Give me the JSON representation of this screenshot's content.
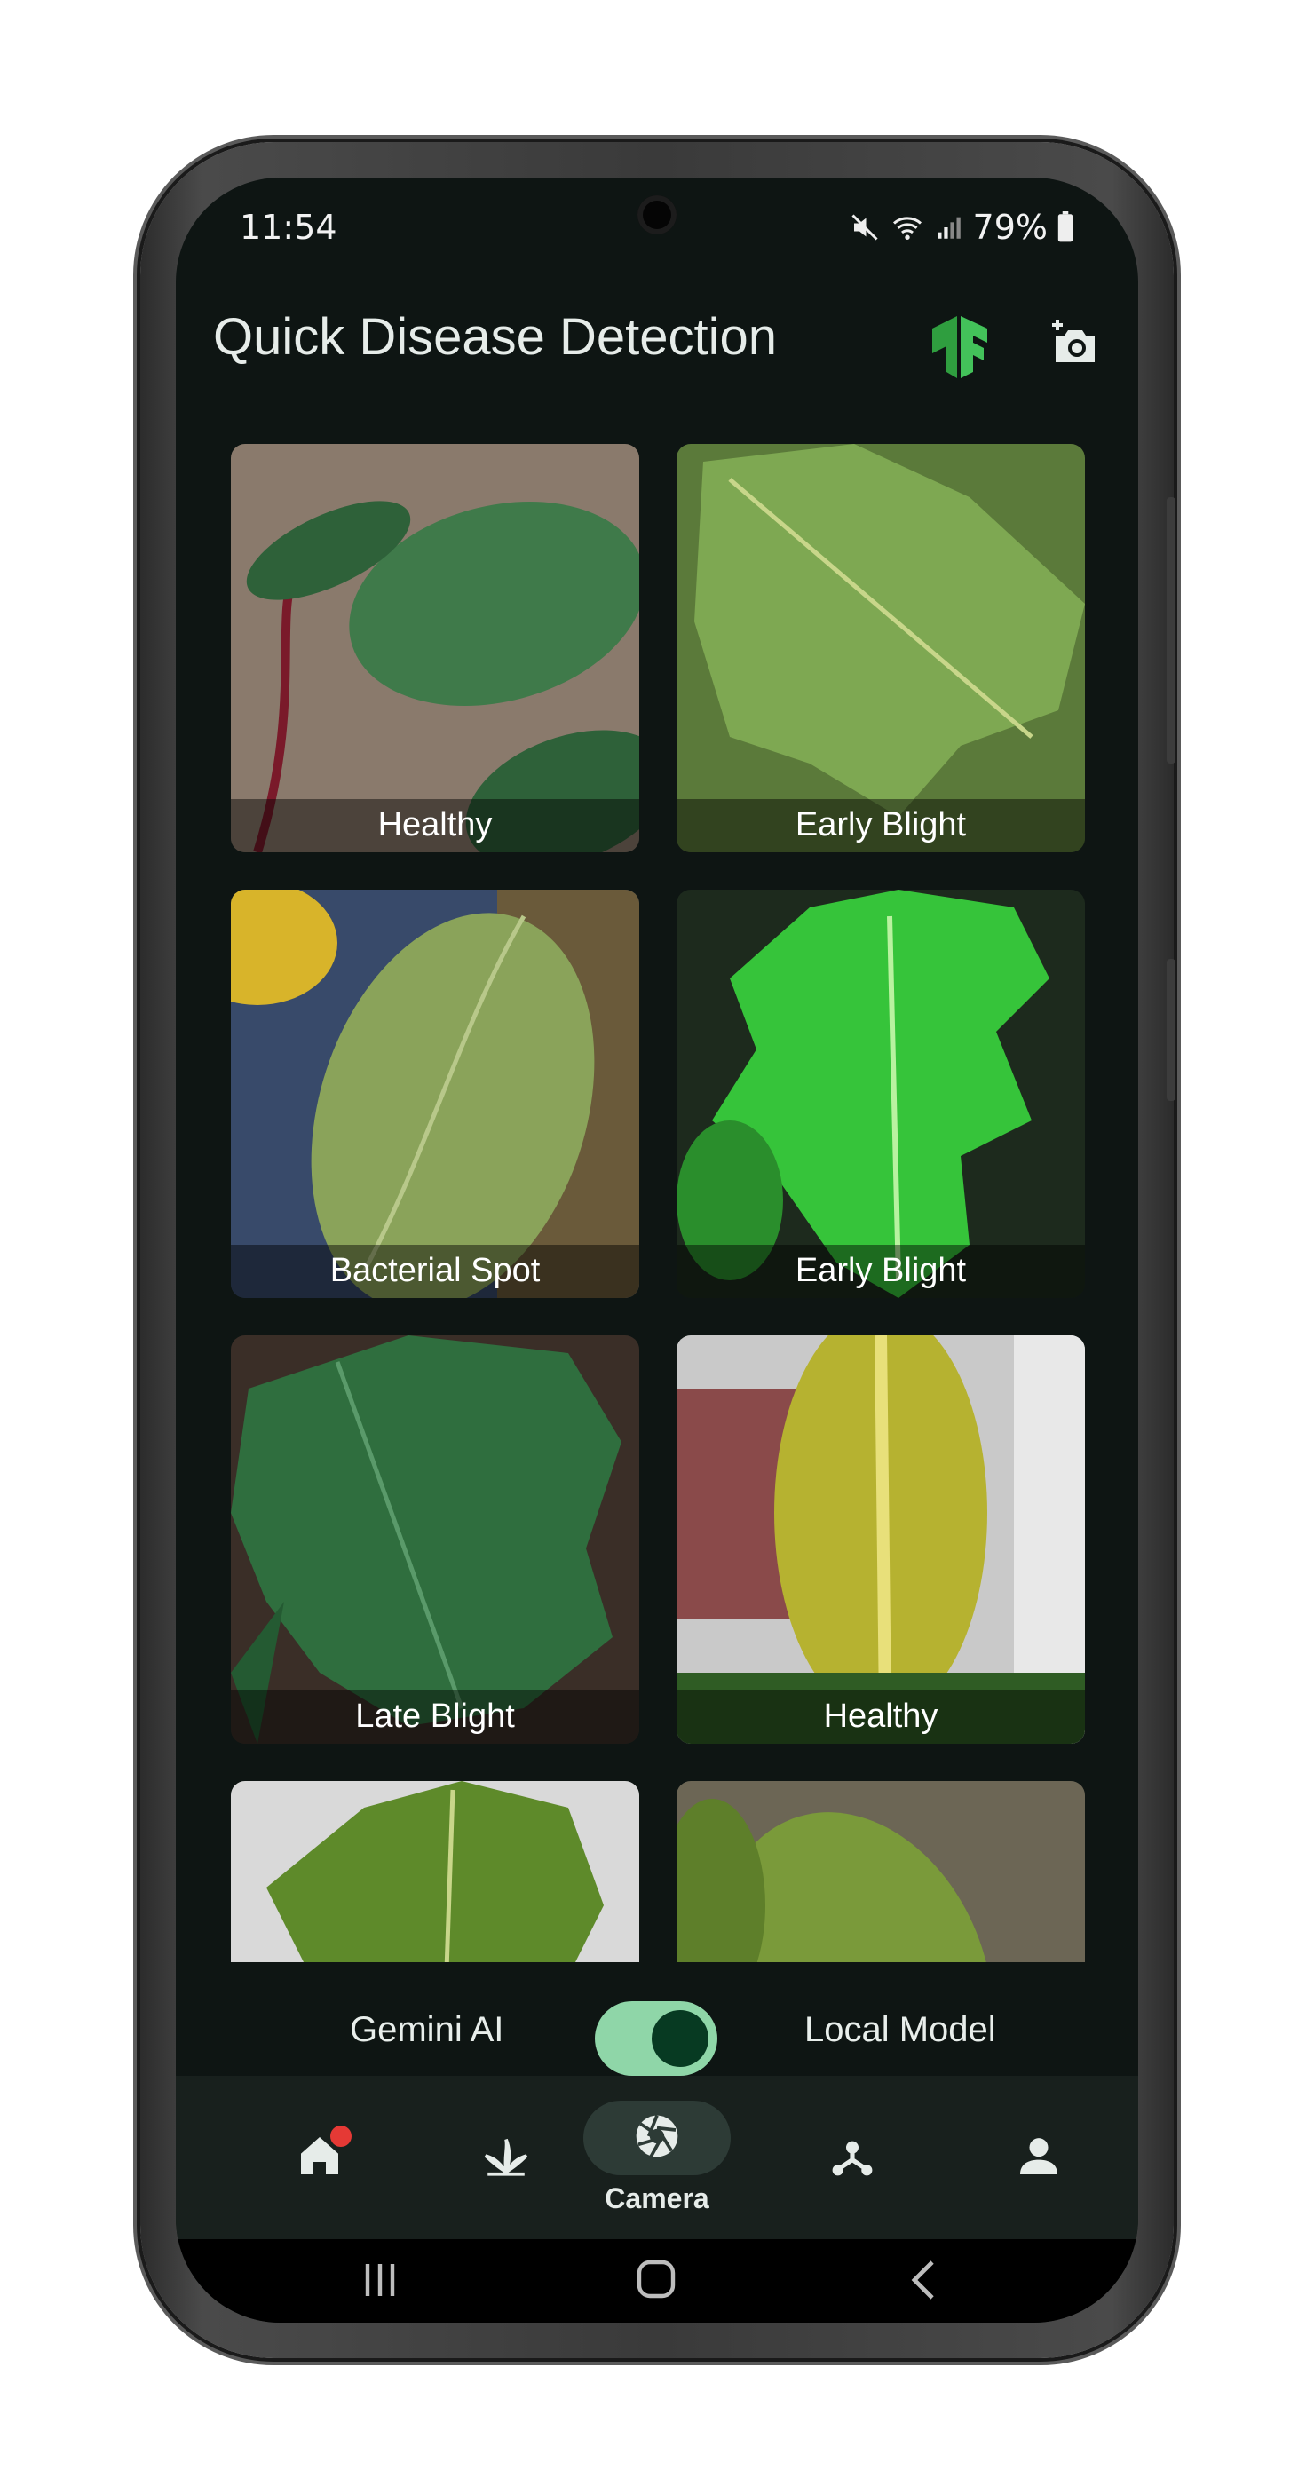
{
  "status_bar": {
    "time": "11:54",
    "battery": "79%",
    "icons": [
      "mute-icon",
      "wifi-icon",
      "signal-icon",
      "battery-icon"
    ]
  },
  "app_bar": {
    "title": "Quick Disease Detection",
    "actions": [
      "tensorflow-logo",
      "add-photo-icon"
    ]
  },
  "gallery": {
    "items": [
      {
        "label": "Healthy",
        "palette": [
          "#8a7a6c",
          "#3f7a4a",
          "#2e6139"
        ]
      },
      {
        "label": "Early Blight",
        "palette": [
          "#5b7a3a",
          "#7ea852",
          "#4a6a2d"
        ]
      },
      {
        "label": "Bacterial Spot",
        "palette": [
          "#384a6a",
          "#8aa35a",
          "#6f8a45"
        ]
      },
      {
        "label": "Early Blight",
        "palette": [
          "#1d2a1d",
          "#36c43a",
          "#2a8e2c"
        ]
      },
      {
        "label": "Late Blight",
        "palette": [
          "#3a2e27",
          "#2f6e3e",
          "#245a32"
        ]
      },
      {
        "label": "Healthy",
        "palette": [
          "#c9c9c9",
          "#b6b230",
          "#2f5c24"
        ]
      },
      {
        "label": "",
        "palette": [
          "#d9d9d9",
          "#5e8a2a",
          "#7aa83a"
        ]
      },
      {
        "label": "",
        "palette": [
          "#6c6655",
          "#7a9a3a",
          "#5e7f2a"
        ]
      }
    ]
  },
  "model_toggle": {
    "left_label": "Gemini AI",
    "right_label": "Local Model",
    "selected": "Local Model"
  },
  "bottom_nav": {
    "items": [
      {
        "name": "home",
        "icon": "home-icon",
        "label": ""
      },
      {
        "name": "plants",
        "icon": "plant-icon",
        "label": ""
      },
      {
        "name": "camera",
        "icon": "camera-shutter-icon",
        "label": "Camera"
      },
      {
        "name": "network",
        "icon": "hub-icon",
        "label": ""
      },
      {
        "name": "profile",
        "icon": "person-icon",
        "label": ""
      }
    ],
    "active": "Camera"
  },
  "colors": {
    "background": "#0e1513",
    "accent": "#8fd6a8",
    "brand_green": "#36b24a",
    "badge": "#e53935"
  }
}
